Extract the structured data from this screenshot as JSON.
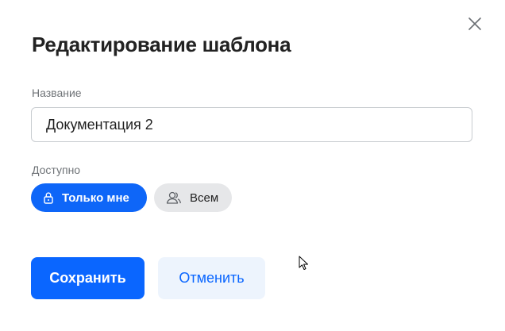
{
  "dialog": {
    "title": "Редактирование шаблона",
    "close_icon": "close-icon"
  },
  "name_field": {
    "label": "Название",
    "value": "Документация 2"
  },
  "access": {
    "label": "Доступно",
    "options": [
      {
        "label": "Только мне",
        "icon": "lock-icon",
        "selected": true
      },
      {
        "label": "Всем",
        "icon": "users-icon",
        "selected": false
      }
    ]
  },
  "actions": {
    "save_label": "Сохранить",
    "cancel_label": "Отменить"
  },
  "colors": {
    "accent": "#0a66ff",
    "secondary_bg": "#edf4fd",
    "chip_inactive_bg": "#e6e7e9"
  }
}
